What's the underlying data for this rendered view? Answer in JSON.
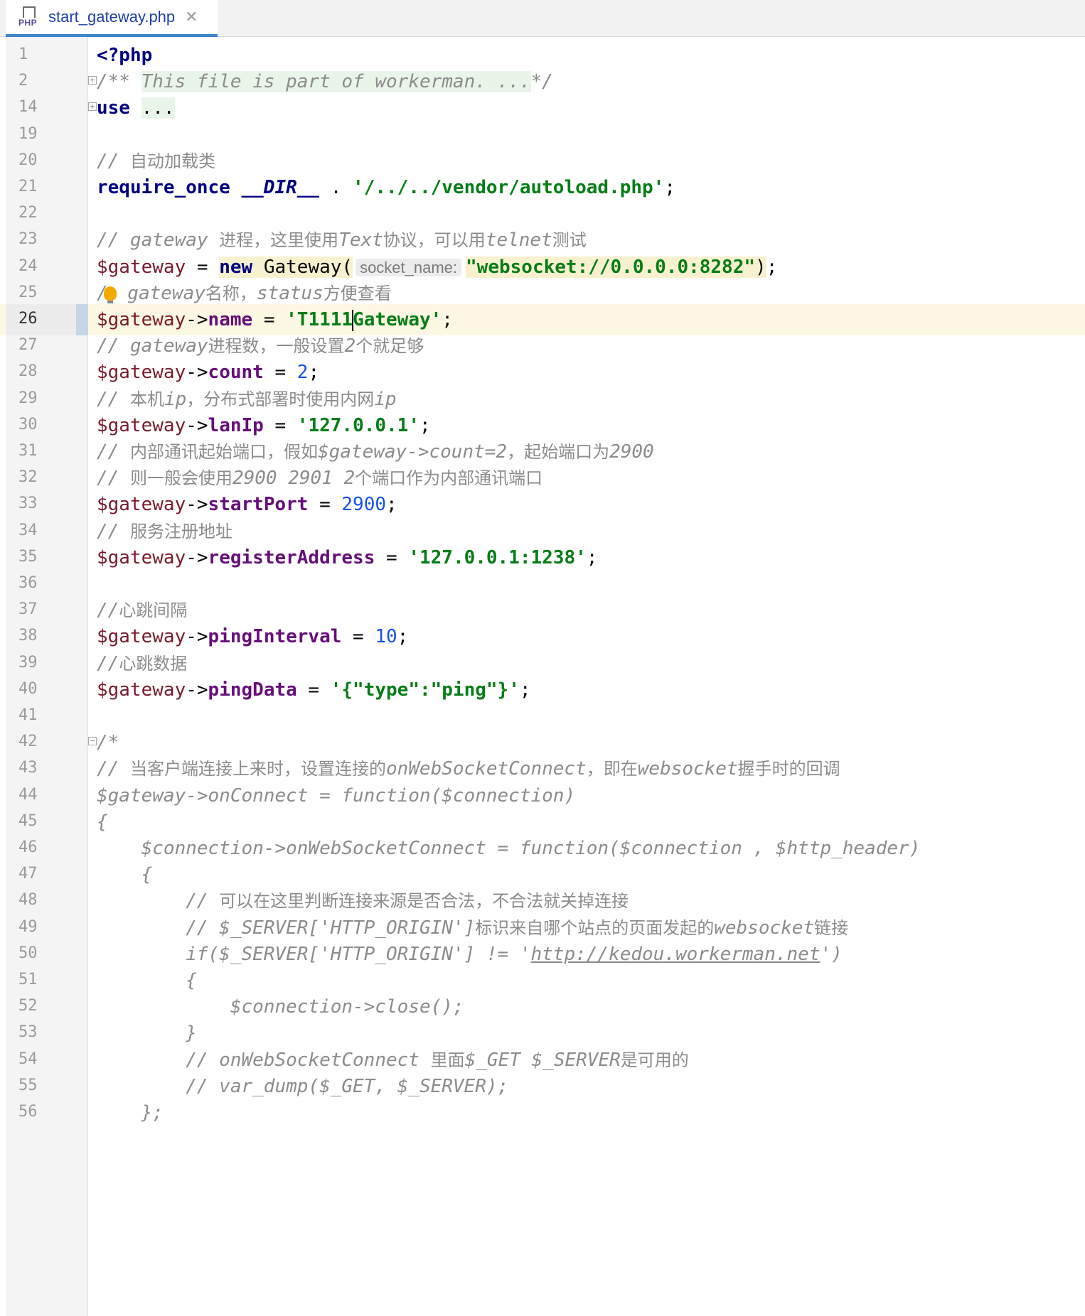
{
  "tab": {
    "icon": "php-file-icon",
    "icon_text": "PHP",
    "title": "start_gateway.php",
    "close": "✕"
  },
  "editor": {
    "current_line": "26",
    "lines": [
      {
        "n": "1",
        "fold": "",
        "segs": [
          [
            "kw",
            "<?php"
          ]
        ]
      },
      {
        "n": "2",
        "fold": "plus",
        "segs": [
          [
            "cmt",
            "/** "
          ],
          [
            "cmtf",
            "This file is part of workerman. ..."
          ],
          [
            "cmt",
            "*/"
          ]
        ]
      },
      {
        "n": "14",
        "fold": "plus",
        "segs": [
          [
            "kw",
            "use"
          ],
          [
            "plain",
            " "
          ],
          [
            "fold-text",
            "..."
          ]
        ]
      },
      {
        "n": "19",
        "fold": "",
        "segs": []
      },
      {
        "n": "20",
        "fold": "",
        "segs": [
          [
            "cmt",
            "// "
          ],
          [
            "cmtcjk",
            "自动加载类"
          ]
        ]
      },
      {
        "n": "21",
        "fold": "",
        "segs": [
          [
            "kw",
            "require_once"
          ],
          [
            "plain",
            " "
          ],
          [
            "kwi",
            "__DIR__"
          ],
          [
            "plain",
            " . "
          ],
          [
            "str",
            "'/../../vendor/autoload.php'"
          ],
          [
            "plain",
            ";"
          ]
        ]
      },
      {
        "n": "22",
        "fold": "",
        "segs": []
      },
      {
        "n": "23",
        "fold": "",
        "segs": [
          [
            "cmt",
            "// gateway "
          ],
          [
            "cmtcjk",
            "进程，这里使用"
          ],
          [
            "cmt",
            "Text"
          ],
          [
            "cmtcjk",
            "协议，可以用"
          ],
          [
            "cmt",
            "telnet"
          ],
          [
            "cmtcjk",
            "测试"
          ]
        ]
      },
      {
        "n": "24",
        "fold": "",
        "segs": [
          [
            "var2",
            "$gateway"
          ],
          [
            "plain",
            " = "
          ],
          [
            "kwhl",
            "new"
          ],
          [
            "hl",
            " Gateway("
          ],
          [
            "hint",
            "socket_name:"
          ],
          [
            "strhl",
            "\"websocket://0.0.0.0:8282\""
          ],
          [
            "hl",
            ")"
          ],
          [
            "plain",
            ";"
          ]
        ]
      },
      {
        "n": "25",
        "fold": "",
        "segs": [
          [
            "cmt",
            "/"
          ],
          [
            "bulb",
            ""
          ],
          [
            "cmt",
            " gateway"
          ],
          [
            "cmtcjk",
            "名称，"
          ],
          [
            "cmt",
            "status"
          ],
          [
            "cmtcjk",
            "方便查看"
          ]
        ]
      },
      {
        "n": "26",
        "fold": "",
        "segs": [
          [
            "var2",
            "$gateway"
          ],
          [
            "plain",
            "->"
          ],
          [
            "prop",
            "name"
          ],
          [
            "plain",
            " = "
          ],
          [
            "str",
            "'T1111"
          ],
          [
            "cursor",
            ""
          ],
          [
            "str",
            "Gateway'"
          ],
          [
            "plain",
            ";"
          ]
        ]
      },
      {
        "n": "27",
        "fold": "",
        "segs": [
          [
            "cmt",
            "// gateway"
          ],
          [
            "cmtcjk",
            "进程数，一般设置"
          ],
          [
            "cmt",
            "2"
          ],
          [
            "cmtcjk",
            "个就足够"
          ]
        ]
      },
      {
        "n": "28",
        "fold": "",
        "segs": [
          [
            "var2",
            "$gateway"
          ],
          [
            "plain",
            "->"
          ],
          [
            "prop",
            "count"
          ],
          [
            "plain",
            " = "
          ],
          [
            "num",
            "2"
          ],
          [
            "plain",
            ";"
          ]
        ]
      },
      {
        "n": "29",
        "fold": "",
        "segs": [
          [
            "cmt",
            "// "
          ],
          [
            "cmtcjk",
            "本机"
          ],
          [
            "cmt",
            "ip"
          ],
          [
            "cmtcjk",
            "，分布式部署时使用内网"
          ],
          [
            "cmt",
            "ip"
          ]
        ]
      },
      {
        "n": "30",
        "fold": "",
        "segs": [
          [
            "var2",
            "$gateway"
          ],
          [
            "plain",
            "->"
          ],
          [
            "prop",
            "lanIp"
          ],
          [
            "plain",
            " = "
          ],
          [
            "str",
            "'127.0.0.1'"
          ],
          [
            "plain",
            ";"
          ]
        ]
      },
      {
        "n": "31",
        "fold": "",
        "segs": [
          [
            "cmt",
            "// "
          ],
          [
            "cmtcjk",
            "内部通讯起始端口，假如"
          ],
          [
            "cmt",
            "$gateway->count=2"
          ],
          [
            "cmtcjk",
            "，起始端口为"
          ],
          [
            "cmt",
            "2900"
          ]
        ]
      },
      {
        "n": "32",
        "fold": "",
        "segs": [
          [
            "cmt",
            "// "
          ],
          [
            "cmtcjk",
            "则一般会使用"
          ],
          [
            "cmt",
            "2900 2901 2"
          ],
          [
            "cmtcjk",
            "个端口作为内部通讯端口"
          ]
        ]
      },
      {
        "n": "33",
        "fold": "",
        "segs": [
          [
            "var2",
            "$gateway"
          ],
          [
            "plain",
            "->"
          ],
          [
            "prop",
            "startPort"
          ],
          [
            "plain",
            " = "
          ],
          [
            "num",
            "2900"
          ],
          [
            "plain",
            ";"
          ]
        ]
      },
      {
        "n": "34",
        "fold": "",
        "segs": [
          [
            "cmt",
            "// "
          ],
          [
            "cmtcjk",
            "服务注册地址"
          ]
        ]
      },
      {
        "n": "35",
        "fold": "",
        "segs": [
          [
            "var2",
            "$gateway"
          ],
          [
            "plain",
            "->"
          ],
          [
            "prop",
            "registerAddress"
          ],
          [
            "plain",
            " = "
          ],
          [
            "str",
            "'127.0.0.1:1238'"
          ],
          [
            "plain",
            ";"
          ]
        ]
      },
      {
        "n": "36",
        "fold": "",
        "segs": []
      },
      {
        "n": "37",
        "fold": "",
        "segs": [
          [
            "cmt",
            "//"
          ],
          [
            "cmtcjk",
            "心跳间隔"
          ]
        ]
      },
      {
        "n": "38",
        "fold": "",
        "segs": [
          [
            "var2",
            "$gateway"
          ],
          [
            "plain",
            "->"
          ],
          [
            "prop",
            "pingInterval"
          ],
          [
            "plain",
            " = "
          ],
          [
            "num",
            "10"
          ],
          [
            "plain",
            ";"
          ]
        ]
      },
      {
        "n": "39",
        "fold": "",
        "segs": [
          [
            "cmt",
            "//"
          ],
          [
            "cmtcjk",
            "心跳数据"
          ]
        ]
      },
      {
        "n": "40",
        "fold": "",
        "segs": [
          [
            "var2",
            "$gateway"
          ],
          [
            "plain",
            "->"
          ],
          [
            "prop",
            "pingData"
          ],
          [
            "plain",
            " = "
          ],
          [
            "str",
            "'{\"type\":\"ping\"}'"
          ],
          [
            "plain",
            ";"
          ]
        ]
      },
      {
        "n": "41",
        "fold": "",
        "segs": []
      },
      {
        "n": "42",
        "fold": "minus",
        "segs": [
          [
            "cmt",
            "/*"
          ]
        ]
      },
      {
        "n": "43",
        "fold": "",
        "segs": [
          [
            "cmt",
            "// "
          ],
          [
            "cmtcjk",
            "当客户端连接上来时，设置连接的"
          ],
          [
            "cmt",
            "onWebSocketConnect"
          ],
          [
            "cmtcjk",
            "，即在"
          ],
          [
            "cmt",
            "websocket"
          ],
          [
            "cmtcjk",
            "握手时的回调"
          ]
        ]
      },
      {
        "n": "44",
        "fold": "",
        "segs": [
          [
            "cmt",
            "$gateway->onConnect = function($connection)"
          ]
        ]
      },
      {
        "n": "45",
        "fold": "",
        "segs": [
          [
            "cmt",
            "{"
          ]
        ]
      },
      {
        "n": "46",
        "fold": "",
        "segs": [
          [
            "cmt",
            "    $connection->onWebSocketConnect = function($connection , $http_header)"
          ]
        ]
      },
      {
        "n": "47",
        "fold": "",
        "segs": [
          [
            "cmt",
            "    {"
          ]
        ]
      },
      {
        "n": "48",
        "fold": "",
        "segs": [
          [
            "cmt",
            "        // "
          ],
          [
            "cmtcjk",
            "可以在这里判断连接来源是否合法，不合法就关掉连接"
          ]
        ]
      },
      {
        "n": "49",
        "fold": "",
        "segs": [
          [
            "cmt",
            "        // $_SERVER['HTTP_ORIGIN']"
          ],
          [
            "cmtcjk",
            "标识来自哪个站点的页面发起的"
          ],
          [
            "cmt",
            "websocket"
          ],
          [
            "cmtcjk",
            "链接"
          ]
        ]
      },
      {
        "n": "50",
        "fold": "",
        "segs": [
          [
            "cmt",
            "        if($_SERVER['HTTP_ORIGIN'] != '"
          ],
          [
            "cmtlink",
            "http://kedou.workerman.net"
          ],
          [
            "cmt",
            "')"
          ]
        ]
      },
      {
        "n": "51",
        "fold": "",
        "segs": [
          [
            "cmt",
            "        {"
          ]
        ]
      },
      {
        "n": "52",
        "fold": "",
        "segs": [
          [
            "cmt",
            "            $connection->close();"
          ]
        ]
      },
      {
        "n": "53",
        "fold": "",
        "segs": [
          [
            "cmt",
            "        }"
          ]
        ]
      },
      {
        "n": "54",
        "fold": "",
        "segs": [
          [
            "cmt",
            "        // onWebSocketConnect "
          ],
          [
            "cmtcjk",
            "里面"
          ],
          [
            "cmt",
            "$_GET $_SERVER"
          ],
          [
            "cmtcjk",
            "是可用的"
          ]
        ]
      },
      {
        "n": "55",
        "fold": "",
        "segs": [
          [
            "cmt",
            "        // var_dump($_GET, $_SERVER);"
          ]
        ]
      },
      {
        "n": "56",
        "fold": "",
        "segs": [
          [
            "cmt",
            "    };"
          ]
        ]
      }
    ]
  }
}
